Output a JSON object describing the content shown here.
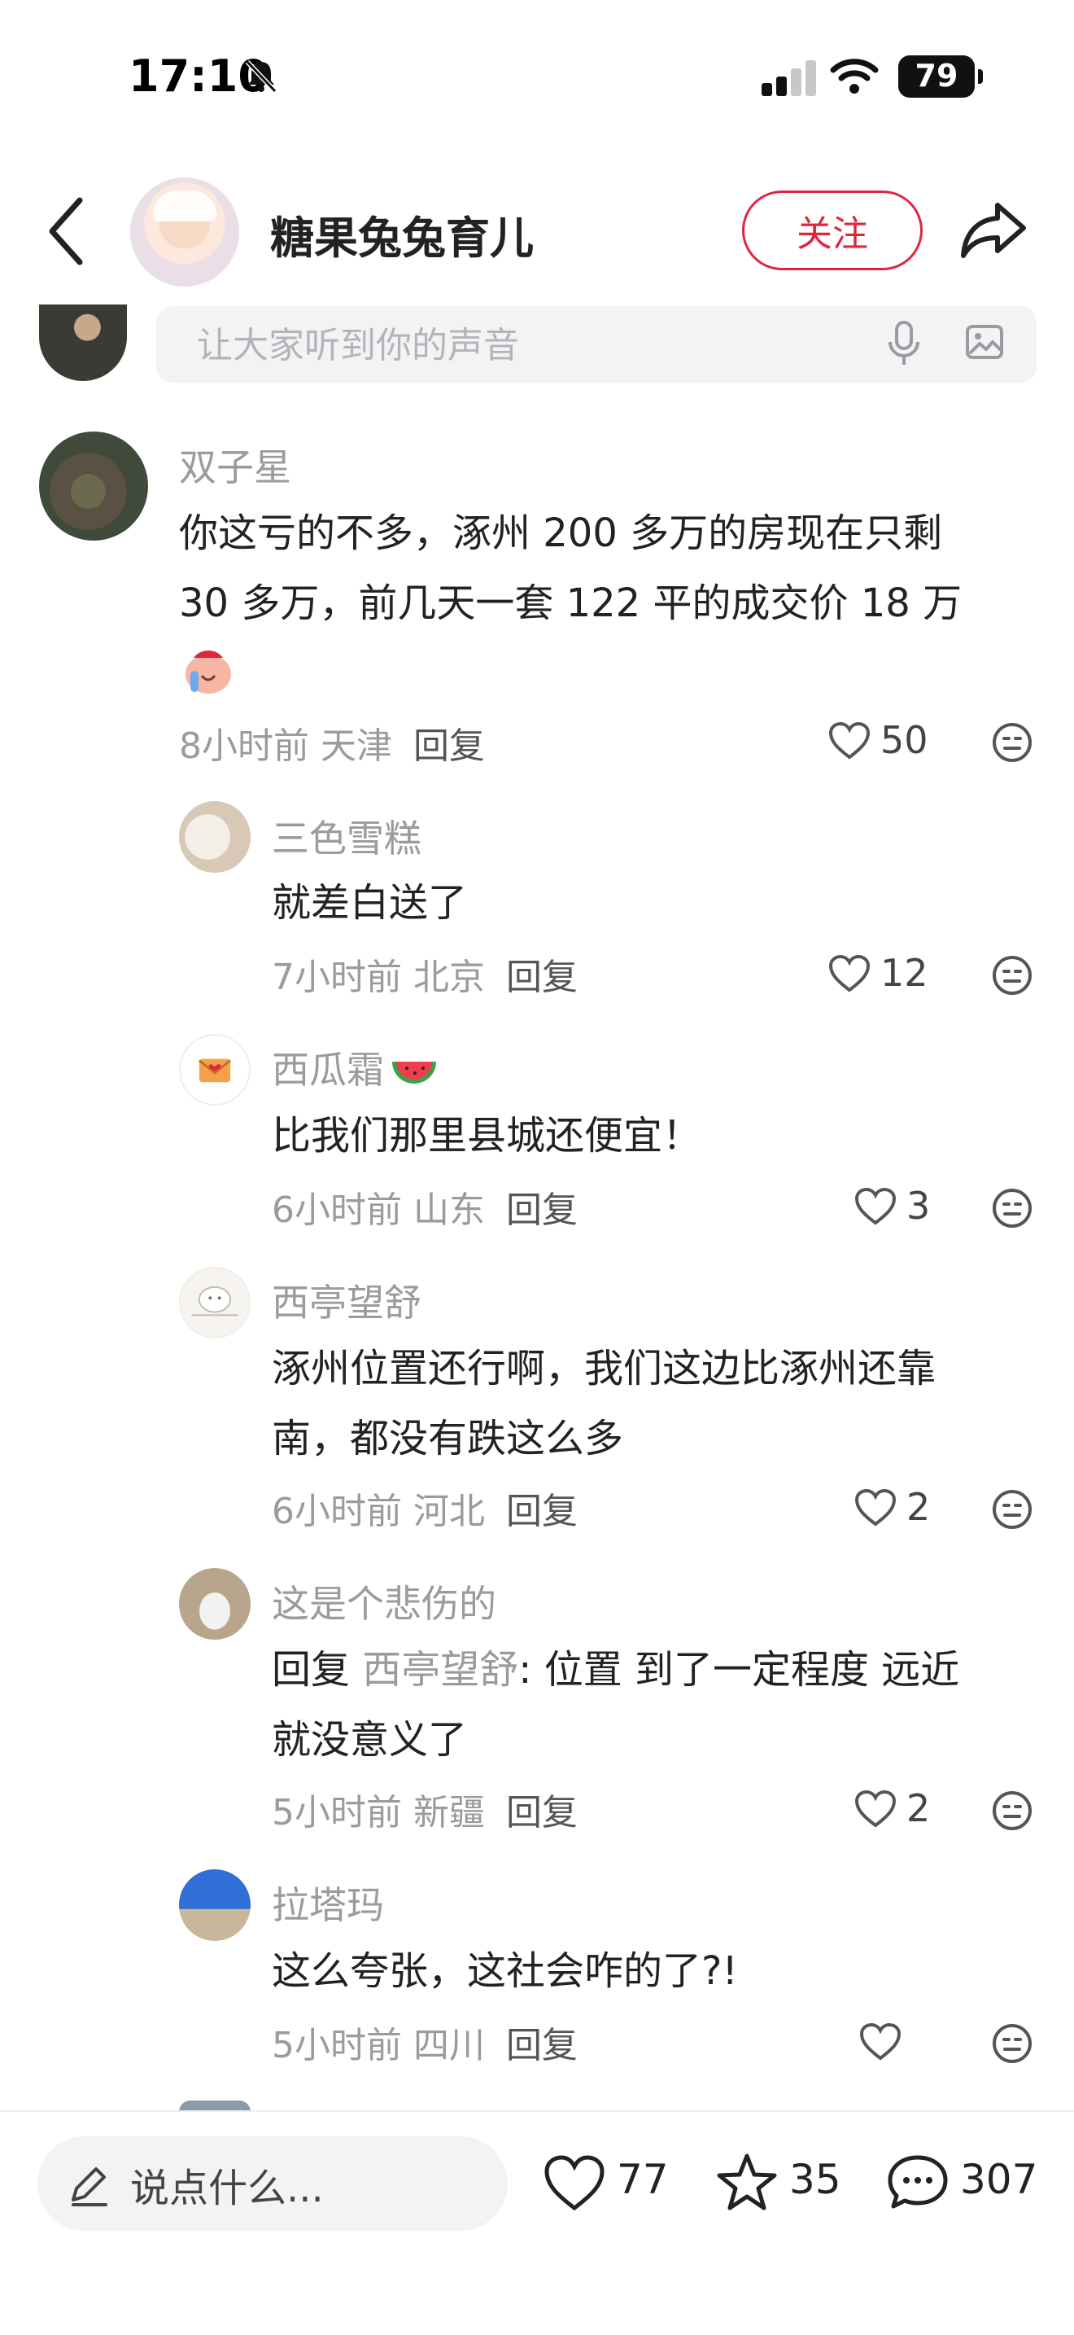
{
  "status_bar": {
    "time": "17:10",
    "battery": "79"
  },
  "header": {
    "title": "糖果兔兔育儿",
    "follow_label": "关注"
  },
  "comment_input": {
    "placeholder": "让大家听到你的声音"
  },
  "comments": [
    {
      "user": "双子星",
      "text_line1": "你这亏的不多，涿州 200 多万的房现在只剩",
      "text_line2": "30 多万，前几天一套 122 平的成交价 18 万",
      "time": "8小时前",
      "location": "天津",
      "reply_label": "回复",
      "likes": "50"
    },
    {
      "user": "三色雪糕",
      "text": "就差白送了",
      "time": "7小时前",
      "location": "北京",
      "reply_label": "回复",
      "likes": "12"
    },
    {
      "user": "西瓜霜",
      "text": "比我们那里县城还便宜！",
      "time": "6小时前",
      "location": "山东",
      "reply_label": "回复",
      "likes": "3"
    },
    {
      "user": "西亭望舒",
      "text_line1": "涿州位置还行啊，我们这边比涿州还靠",
      "text_line2": "南，都没有跌这么多",
      "time": "6小时前",
      "location": "河北",
      "reply_label": "回复",
      "likes": "2"
    },
    {
      "user": "这是个悲伤的",
      "reply_prefix": "回复",
      "reply_to": "西亭望舒",
      "text_line1": ": 位置 到了一定程度  远近",
      "text_line2": "就没意义了",
      "time": "5小时前",
      "location": "新疆",
      "reply_label": "回复",
      "likes": "2"
    },
    {
      "user": "拉塔玛",
      "text": "这么夸张，这社会咋的了?!",
      "time": "5小时前",
      "location": "四川",
      "reply_label": "回复",
      "likes": ""
    }
  ],
  "bottom_bar": {
    "placeholder": "说点什么...",
    "likes": "77",
    "favorites": "35",
    "comments": "307"
  },
  "colors": {
    "accent": "#e0263f",
    "muted_text": "#9a9a9f",
    "input_bg": "#f3f3f5"
  }
}
